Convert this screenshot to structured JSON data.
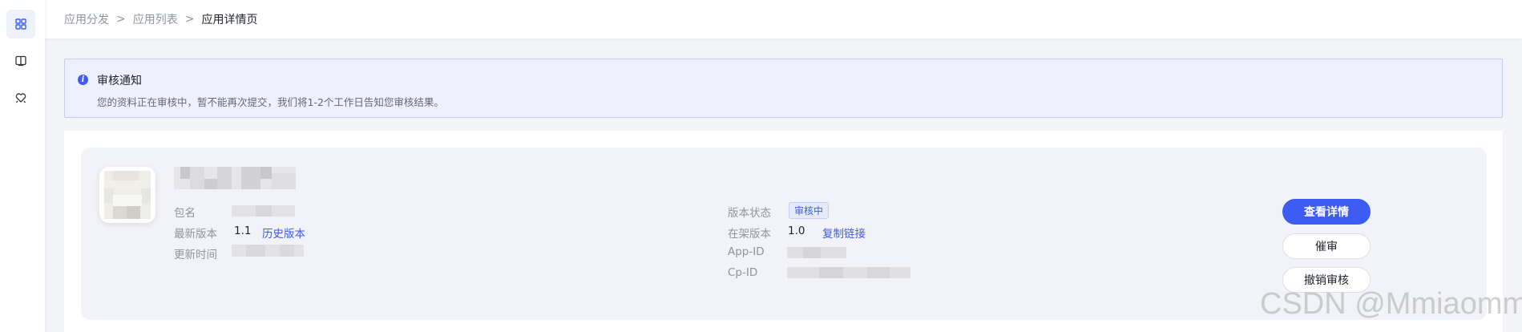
{
  "sidebar": {
    "items": [
      {
        "icon": "grid-icon",
        "active": true
      },
      {
        "icon": "book-icon",
        "active": false
      },
      {
        "icon": "heart-badge-icon",
        "active": false
      }
    ]
  },
  "breadcrumb": {
    "items": [
      "应用分发",
      "应用列表",
      "应用详情页"
    ],
    "separator": ">"
  },
  "notice": {
    "title": "审核通知",
    "text": "您的资料正在审核中，暂不能再次提交，我们将1-2个工作日告知您审核结果。"
  },
  "app": {
    "left_fields": {
      "package_label": "包名",
      "latest_version_label": "最新版本",
      "latest_version_value": "1.1",
      "history_link": "历史版本",
      "update_time_label": "更新时间"
    },
    "right_fields": {
      "version_status_label": "版本状态",
      "version_status_value": "审核中",
      "listed_version_label": "在架版本",
      "listed_version_value": "1.0",
      "copy_link": "复制链接",
      "app_id_label": "App-ID",
      "cp_id_label": "Cp-ID"
    }
  },
  "actions": {
    "details": "查看详情",
    "urge": "催审",
    "cancel": "撤销审核"
  },
  "watermark": "CSDN @Mmiaomm_",
  "colors": {
    "accent": "#3d5cf5",
    "notice_bg": "#eef0fd",
    "card_bg": "#f2f3f8"
  }
}
